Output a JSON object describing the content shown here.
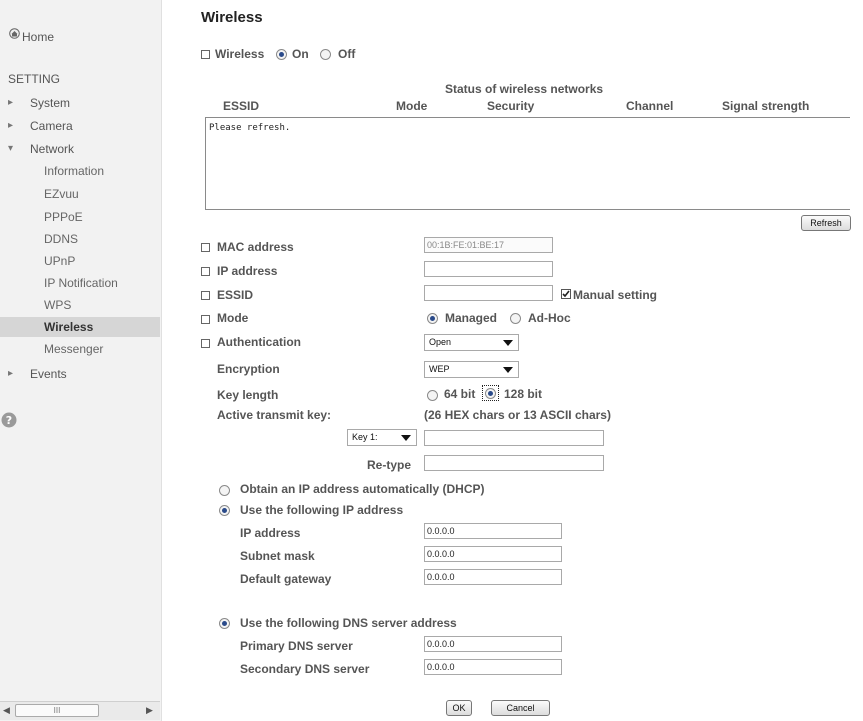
{
  "sidebar": {
    "home": "Home",
    "setting": "SETTING",
    "system": "System",
    "camera": "Camera",
    "network": "Network",
    "network_items": [
      "Information",
      "EZvuu",
      "PPPoE",
      "DDNS",
      "UPnP",
      "IP Notification",
      "WPS",
      "Wireless",
      "Messenger"
    ],
    "selected": "Wireless",
    "events": "Events",
    "scrollbar_grip": "III"
  },
  "page": {
    "title": "Wireless"
  },
  "wireless_toggle": {
    "label": "Wireless",
    "on": "On",
    "off": "Off",
    "value": "On"
  },
  "status_table": {
    "title": "Status of wireless networks",
    "columns": [
      "ESSID",
      "Mode",
      "Security",
      "Channel",
      "Signal strength"
    ],
    "content": "Please refresh.",
    "refresh_button": "Refresh"
  },
  "form": {
    "mac_label": "MAC address",
    "mac_value": "00:1B:FE:01:BE:17",
    "ip_label": "IP address",
    "ip_value": "",
    "essid_label": "ESSID",
    "essid_value": "",
    "manual_setting": "Manual setting",
    "manual_checked": true,
    "mode_label": "Mode",
    "mode_managed": "Managed",
    "mode_adhoc": "Ad-Hoc",
    "auth_label": "Authentication",
    "auth_value": "Open",
    "enc_label": "Encryption",
    "enc_value": "WEP",
    "keylen_label": "Key length",
    "keylen_64": "64 bit",
    "keylen_128": "128 bit",
    "active_key_label": "Active transmit key:",
    "key_hint": "(26 HEX chars or 13 ASCII chars)",
    "key_select": "Key 1:",
    "key_value": "",
    "retype_label": "Re-type",
    "retype_value": ""
  },
  "ip_config": {
    "dhcp_label": "Obtain an IP address automatically (DHCP)",
    "static_label": "Use the following IP address",
    "ip_label": "IP address",
    "ip_value": "0.0.0.0",
    "subnet_label": "Subnet mask",
    "subnet_value": "0.0.0.0",
    "gateway_label": "Default gateway",
    "gateway_value": "0.0.0.0",
    "dns_label": "Use the following DNS server address",
    "primary_label": "Primary DNS server",
    "primary_value": "0.0.0.0",
    "secondary_label": "Secondary DNS server",
    "secondary_value": "0.0.0.0"
  },
  "buttons": {
    "ok": "OK",
    "cancel": "Cancel"
  },
  "colors": {
    "sidebar_bg": "#f2f2f2",
    "selected_bg": "#d6d6d6",
    "radio_selected": "#2a4a8a"
  }
}
